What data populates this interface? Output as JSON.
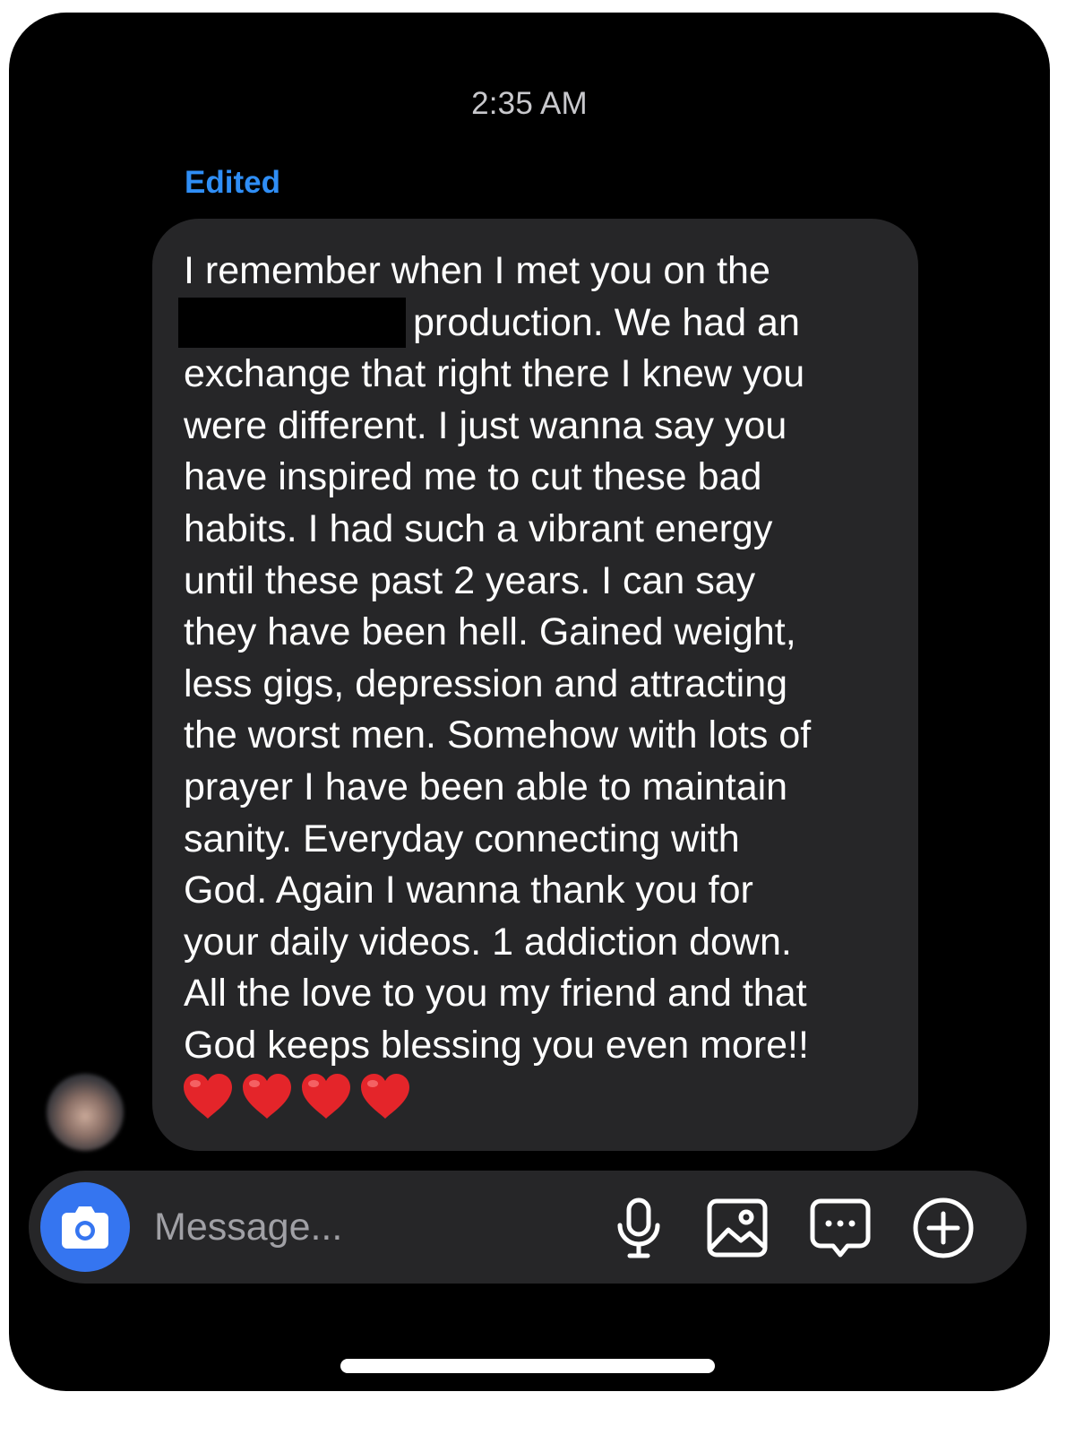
{
  "timestamp": "2:35 AM",
  "edited_label": "Edited",
  "message": {
    "line1": "I remember when I met you on  the",
    "line2": "production. We had an",
    "lines": [
      "exchange that right there I knew you",
      "were different. I just wanna say you",
      "have inspired me to cut these bad",
      "habits. I had such a vibrant energy",
      "until these past 2 years. I can say",
      "they have been hell. Gained weight,",
      "less gigs, depression and attracting",
      "the worst men. Somehow with lots of",
      "prayer I have been able to maintain",
      "sanity. Everyday connecting with",
      "God. Again I wanna thank you for",
      "your daily videos. 1 addiction down.",
      "All the love to you my friend and that",
      "God keeps blessing you even more!!"
    ],
    "emoji_count": 4,
    "emoji": "red-heart-icon"
  },
  "composer": {
    "placeholder": "Message..."
  },
  "icons": {
    "camera": "camera-icon",
    "mic": "microphone-icon",
    "gallery": "gallery-icon",
    "sticker": "chat-bubble-icon",
    "plus": "plus-circle-icon"
  },
  "colors": {
    "background": "#000000",
    "bubble": "#262628",
    "edited_accent": "#2f8ef6",
    "camera_button": "#3575f0",
    "heart": "#e4252a"
  }
}
